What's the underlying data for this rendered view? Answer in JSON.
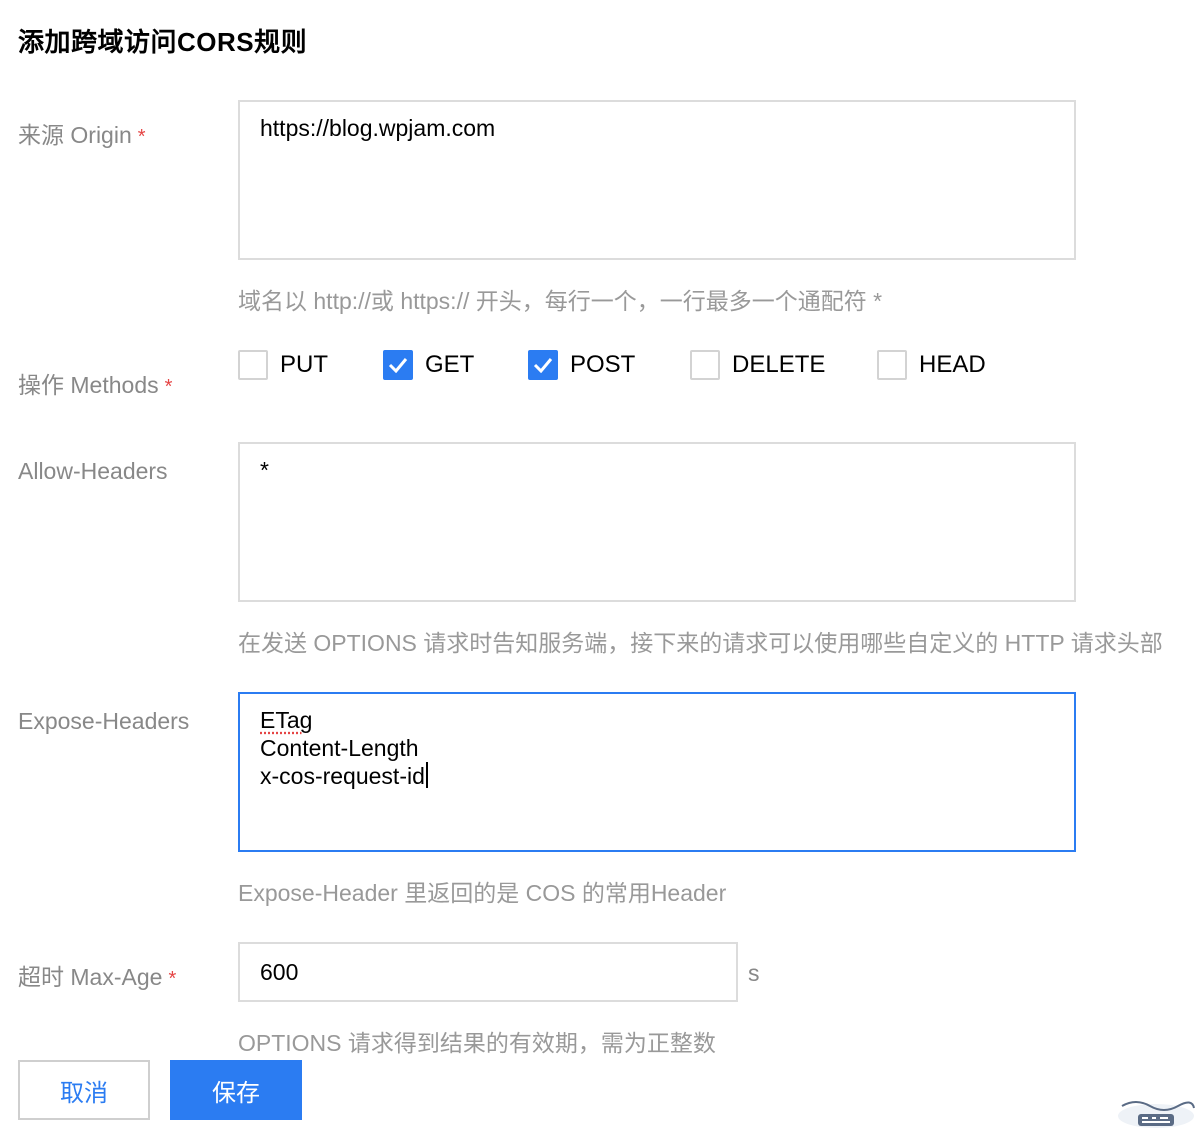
{
  "dialog": {
    "title": "添加跨域访问CORS规则"
  },
  "origin": {
    "label": "来源 Origin",
    "required_mark": "*",
    "value": "https://blog.wpjam.com",
    "hint": "域名以 http://或 https:// 开头，每行一个，一行最多一个通配符 *"
  },
  "methods": {
    "label": "操作 Methods",
    "required_mark": "*",
    "options": [
      {
        "label": "PUT",
        "checked": false
      },
      {
        "label": "GET",
        "checked": true
      },
      {
        "label": "POST",
        "checked": true
      },
      {
        "label": "DELETE",
        "checked": false
      },
      {
        "label": "HEAD",
        "checked": false
      }
    ]
  },
  "allow_headers": {
    "label": "Allow-Headers",
    "value": "*",
    "hint": "在发送 OPTIONS 请求时告知服务端，接下来的请求可以使用哪些自定义的 HTTP 请求头部"
  },
  "expose_headers": {
    "label": "Expose-Headers",
    "lines": [
      "ETag",
      "Content-Length",
      "x-cos-request-id"
    ],
    "hint": "Expose-Header 里返回的是 COS 的常用Header"
  },
  "max_age": {
    "label": "超时 Max-Age",
    "required_mark": "*",
    "value": "600",
    "unit": "s",
    "hint": "OPTIONS 请求得到结果的有效期，需为正整数"
  },
  "buttons": {
    "cancel": "取消",
    "save": "保存"
  },
  "colors": {
    "primary": "#2b7cf2",
    "required": "#e54545"
  }
}
